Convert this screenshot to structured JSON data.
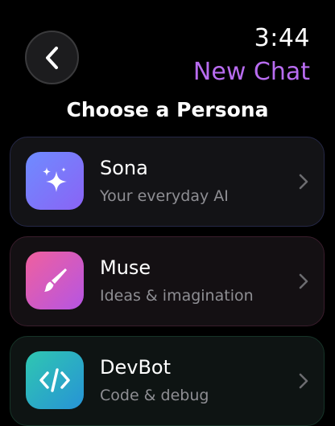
{
  "header": {
    "time": "3:44",
    "title": "New Chat",
    "back_icon": "chevron-left-icon"
  },
  "section": {
    "title": "Choose a Persona"
  },
  "personas": [
    {
      "name": "Sona",
      "description": "Your everyday AI",
      "icon": "sparkles-icon",
      "accent": "#7b78fa"
    },
    {
      "name": "Muse",
      "description": "Ideas & imagination",
      "icon": "paintbrush-icon",
      "accent": "#d85ac4"
    },
    {
      "name": "DevBot",
      "description": "Code & debug",
      "icon": "code-icon",
      "accent": "#2bb0c4"
    }
  ],
  "colors": {
    "background": "#000000",
    "title_accent": "#b86cf0",
    "secondary_text": "#8e8e93"
  }
}
